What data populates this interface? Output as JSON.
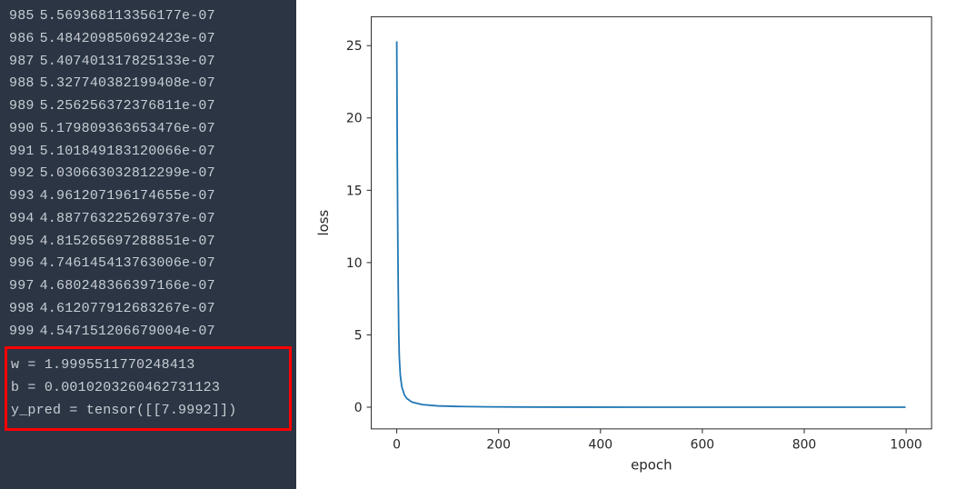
{
  "log": {
    "lines": [
      {
        "epoch": "985",
        "loss": "5.569368113356177e-07"
      },
      {
        "epoch": "986",
        "loss": "5.484209850692423e-07"
      },
      {
        "epoch": "987",
        "loss": "5.407401317825133e-07"
      },
      {
        "epoch": "988",
        "loss": "5.327740382199408e-07"
      },
      {
        "epoch": "989",
        "loss": "5.256256372376811e-07"
      },
      {
        "epoch": "990",
        "loss": "5.179809363653476e-07"
      },
      {
        "epoch": "991",
        "loss": "5.101849183120066e-07"
      },
      {
        "epoch": "992",
        "loss": "5.030663032812299e-07"
      },
      {
        "epoch": "993",
        "loss": "4.961207196174655e-07"
      },
      {
        "epoch": "994",
        "loss": "4.887763225269737e-07"
      },
      {
        "epoch": "995",
        "loss": "4.815265697288851e-07"
      },
      {
        "epoch": "996",
        "loss": "4.746145413763006e-07"
      },
      {
        "epoch": "997",
        "loss": "4.680248366397166e-07"
      },
      {
        "epoch": "998",
        "loss": "4.612077912683267e-07"
      },
      {
        "epoch": "999",
        "loss": "4.547151206679004e-07"
      }
    ],
    "summary": {
      "w_label": "w = ",
      "w_value": " 1.9995511770248413",
      "b_label": "b = ",
      "b_value": " 0.0010203260462731123",
      "ypred_label": "y_pred = ",
      "ypred_value": " tensor([[7.9992]])"
    }
  },
  "chart_data": {
    "type": "line",
    "title": "",
    "xlabel": "epoch",
    "ylabel": "loss",
    "xlim": [
      -50,
      1050
    ],
    "ylim": [
      -1.5,
      27
    ],
    "x_ticks": [
      0,
      200,
      400,
      600,
      800,
      1000
    ],
    "y_ticks": [
      0,
      5,
      10,
      15,
      20,
      25
    ],
    "x": [
      0,
      1,
      2,
      3,
      4,
      5,
      7,
      10,
      15,
      20,
      30,
      50,
      80,
      120,
      180,
      250,
      350,
      500,
      700,
      850,
      999
    ],
    "y": [
      25.3,
      18.0,
      12.0,
      8.0,
      5.0,
      3.5,
      2.2,
      1.4,
      0.85,
      0.6,
      0.35,
      0.18,
      0.09,
      0.05,
      0.025,
      0.012,
      0.005,
      0.001,
      0.0002,
      5e-05,
      5e-07
    ]
  }
}
